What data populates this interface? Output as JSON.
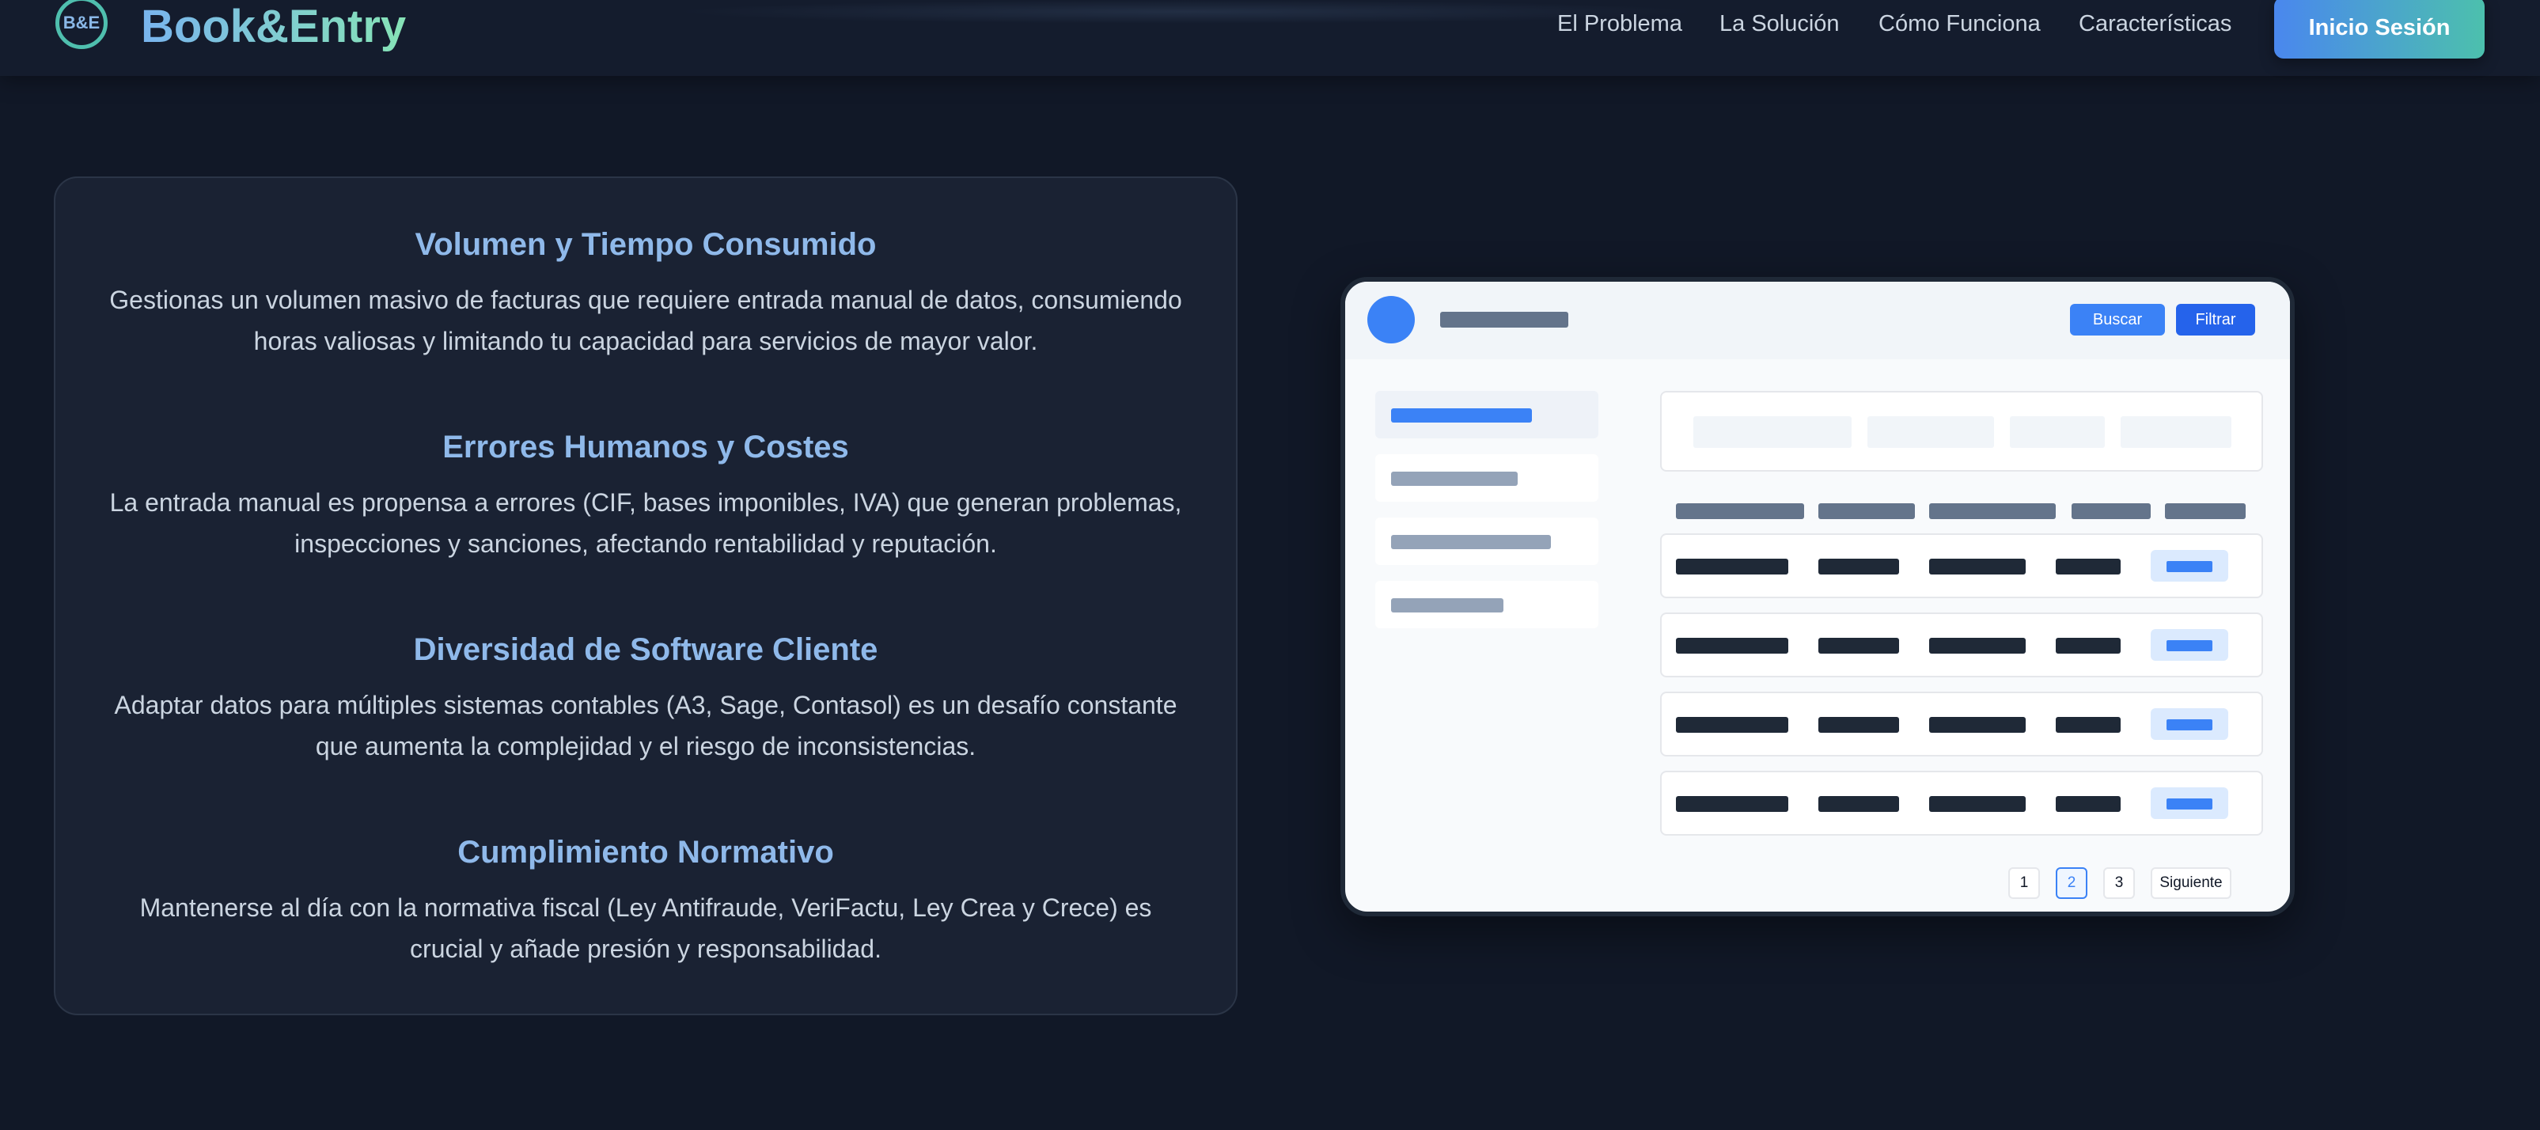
{
  "brand": {
    "logo_text": "B&E",
    "name": "Book&Entry"
  },
  "nav": {
    "links": [
      "El Problema",
      "La Solución",
      "Cómo Funciona",
      "Características"
    ],
    "cta_label": "Inicio Sesión"
  },
  "problems": [
    {
      "title": "Volumen y Tiempo Consumido",
      "lines": [
        "Gestionas un volumen masivo de facturas que requiere entrada manual de datos, consumiendo",
        "horas valiosas y limitando tu capacidad para servicios de mayor valor."
      ]
    },
    {
      "title": "Errores Humanos y Costes",
      "lines": [
        "La entrada manual es propensa a errores (CIF, bases imponibles, IVA) que generan problemas,",
        "inspecciones y sanciones, afectando rentabilidad y reputación."
      ]
    },
    {
      "title": "Diversidad de Software Cliente",
      "lines": [
        "Adaptar datos para múltiples sistemas contables (A3, Sage, Contasol) es un desafío constante",
        "que aumenta la complejidad y el riesgo de inconsistencias."
      ]
    },
    {
      "title": "Cumplimiento Normativo",
      "lines": [
        "Mantenerse al día con la normativa fiscal (Ley Antifraude, VeriFactu, Ley Crea y Crece) es",
        "crucial y añade presión y responsabilidad."
      ]
    }
  ],
  "mockup": {
    "search_label": "Buscar",
    "filter_label": "Filtrar",
    "pagination": [
      "1",
      "2",
      "3",
      "Siguiente"
    ],
    "active_page": "2"
  },
  "colors": {
    "background": "#111827",
    "accent_blue": "#3b82f6",
    "accent_teal": "#4cc0ad",
    "title_blue": "#8fb9ea"
  }
}
